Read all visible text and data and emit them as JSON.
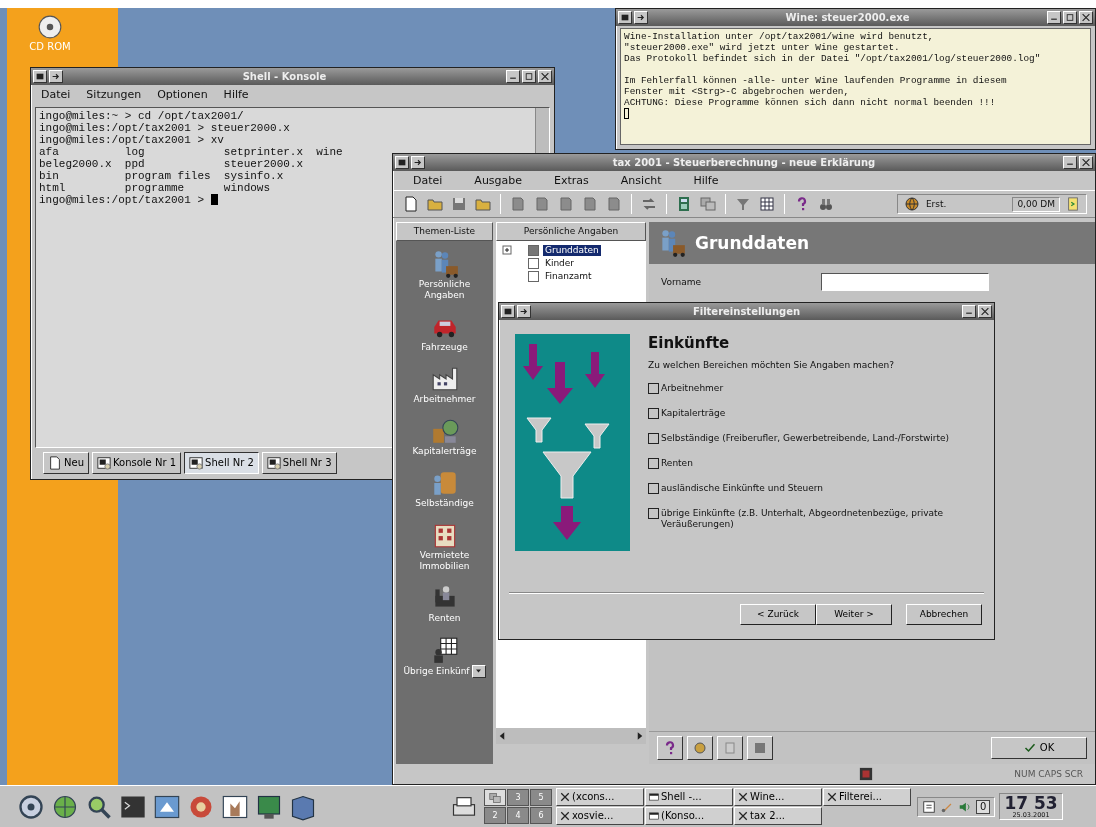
{
  "desktop": {
    "icons": [
      {
        "label": "CD ROM"
      }
    ]
  },
  "konsole": {
    "title": "Shell - Konsole",
    "menu": [
      "Datei",
      "Sitzungen",
      "Optionen",
      "Hilfe"
    ],
    "lines": [
      "ingo@miles:~ > cd /opt/tax2001/",
      "ingo@miles:/opt/tax2001 > steuer2000.x",
      "ingo@miles:/opt/tax2001 > xv",
      "afa          log            setprinter.x  wine",
      "beleg2000.x  ppd            steuer2000.x",
      "bin          program files  sysinfo.x",
      "html         programme      windows",
      "ingo@miles:/opt/tax2001 > "
    ],
    "tabs": [
      {
        "label": "Neu",
        "kind": "new",
        "selected": false
      },
      {
        "label": "Konsole Nr 1",
        "kind": "session",
        "selected": false
      },
      {
        "label": "Shell Nr 2",
        "kind": "session",
        "selected": true
      },
      {
        "label": "Shell Nr 3",
        "kind": "session",
        "selected": false
      }
    ]
  },
  "wine": {
    "title": "Wine: steuer2000.exe",
    "paragraphs": [
      [
        "Wine-Installation unter /opt/tax2001/wine wird benutzt,",
        "\"steuer2000.exe\" wird jetzt unter Wine gestartet.",
        "Das Protokoll befindet sich in der Datei \"/opt/tax2001/log/steuer2000.log\""
      ],
      [
        "Im Fehlerfall können -alle- unter Wine laufenden Programme in diesem",
        "Fenster mit <Strg>-C abgebrochen werden,",
        "ACHTUNG: Diese Programme können sich dann nicht normal beenden !!!"
      ]
    ]
  },
  "tax": {
    "title": "tax 2001 - Steuerberechnung - neue Erklärung",
    "menu": [
      "Datei",
      "Ausgabe",
      "Extras",
      "Ansicht",
      "Hilfe"
    ],
    "status_label": "Erst.",
    "amount": "0,00 DM",
    "themes": {
      "header": "Themen-Liste",
      "items": [
        "Persönliche Angaben",
        "Fahrzeuge",
        "Arbeitnehmer",
        "Kapitalerträge",
        "Selbständige",
        "Vermietete Immobilien",
        "Renten",
        "Übrige Einkünf"
      ]
    },
    "tree": {
      "header": "Persönliche Angaben",
      "items": [
        {
          "label": "Grunddaten",
          "selected": true,
          "expandable": true
        },
        {
          "label": "Kinder",
          "selected": false,
          "expandable": false
        },
        {
          "label": "Finanzamt",
          "selected": false,
          "expandable": false
        }
      ]
    },
    "section": {
      "title": "Grunddaten",
      "fields": [
        {
          "label": "Vorname"
        }
      ]
    },
    "ok_button": "OK",
    "status_bar": "NUM CAPS SCR"
  },
  "dialog": {
    "title": "Filtereinstellungen",
    "heading": "Einkünfte",
    "question": "Zu welchen Bereichen möchten Sie Angaben machen?",
    "options": [
      {
        "label": "Arbeitnehmer",
        "checked": false
      },
      {
        "label": "Kapitalerträge",
        "checked": false
      },
      {
        "label": "Selbständige (Freiberufler, Gewerbetreibende, Land-/Forstwirte)",
        "checked": false
      },
      {
        "label": "Renten",
        "checked": false
      },
      {
        "label": "ausländische Einkünfte und Steuern",
        "checked": false
      },
      {
        "label": "übrige Einkünfte (z.B. Unterhalt, Abgeordnetenbezüge, private Veräußerungen)",
        "checked": false
      }
    ],
    "buttons": [
      "< Zurück",
      "Weiter >",
      "Abbrechen"
    ]
  },
  "taskbar": {
    "desks": [
      "3",
      "5",
      "2",
      "4",
      "6"
    ],
    "tasks": [
      {
        "label": "(xcons...",
        "kind": "x"
      },
      {
        "label": "Shell -...",
        "kind": "window"
      },
      {
        "label": "Wine...",
        "kind": "x"
      },
      {
        "label": "Filterei...",
        "kind": "x"
      },
      {
        "label": "xosvie...",
        "kind": "x"
      },
      {
        "label": "(Konso...",
        "kind": "window"
      },
      {
        "label": "tax 2...",
        "kind": "x"
      }
    ],
    "tray_value": "0",
    "clock": "17 53",
    "date": "25.03.2001"
  }
}
